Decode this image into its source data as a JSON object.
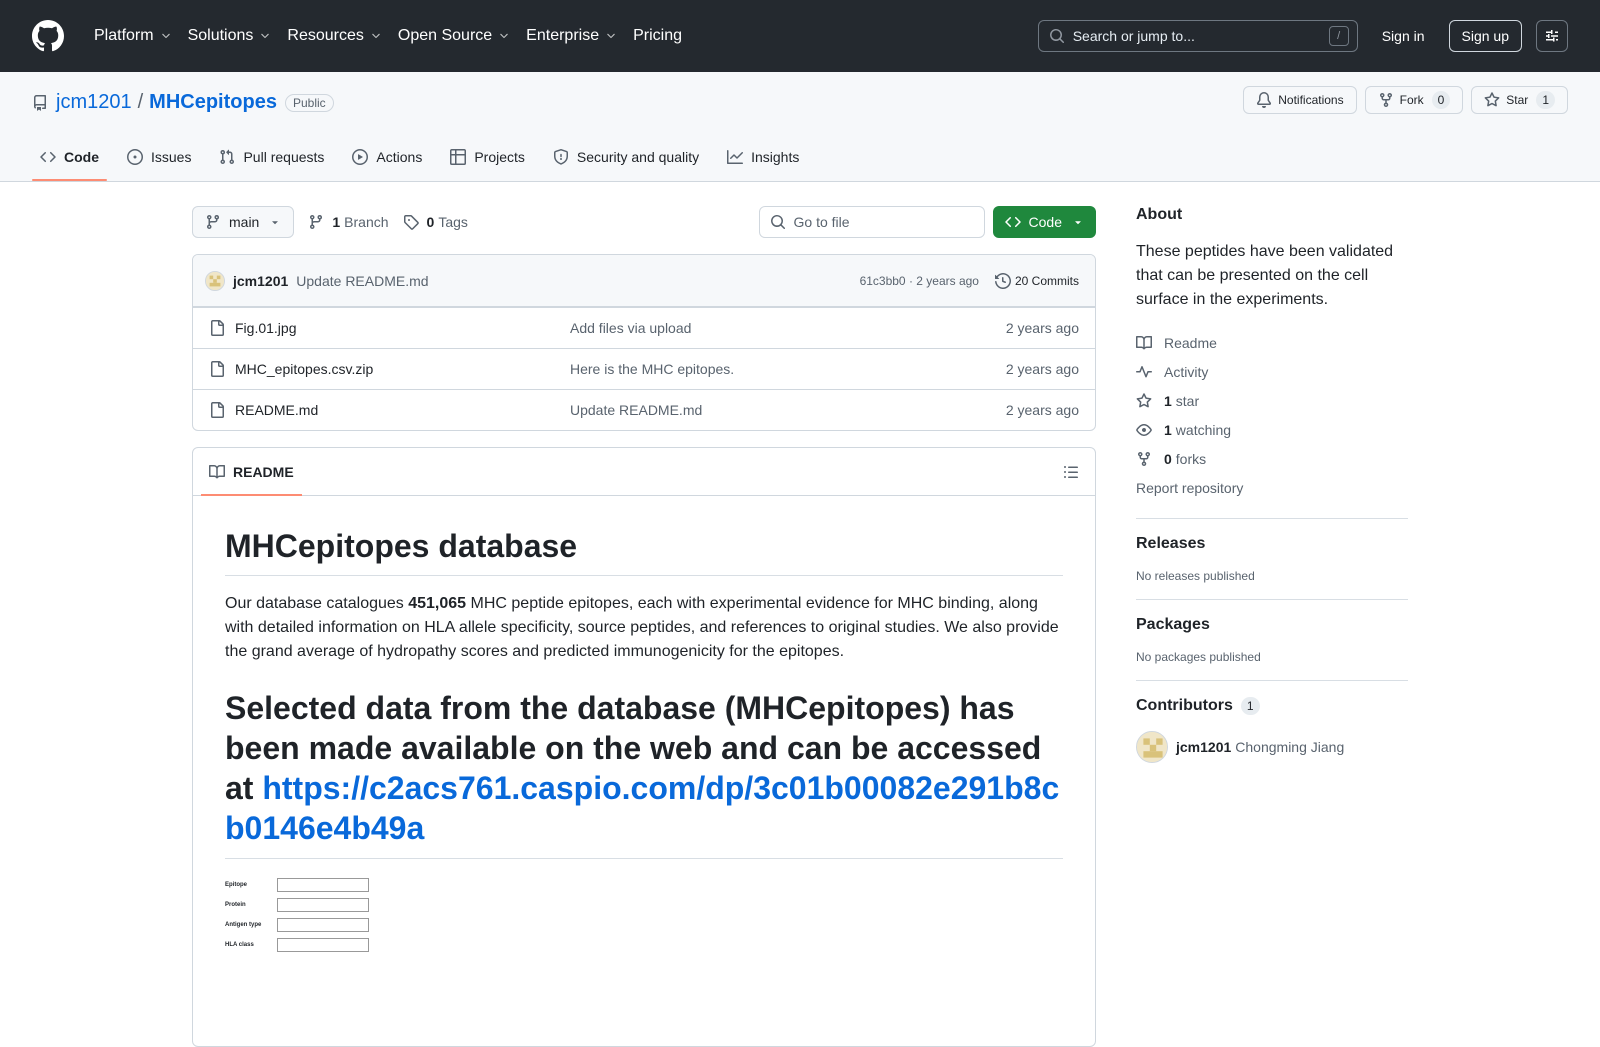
{
  "header": {
    "nav": [
      {
        "label": "Platform",
        "dropdown": true
      },
      {
        "label": "Solutions",
        "dropdown": true
      },
      {
        "label": "Resources",
        "dropdown": true
      },
      {
        "label": "Open Source",
        "dropdown": true
      },
      {
        "label": "Enterprise",
        "dropdown": true
      },
      {
        "label": "Pricing",
        "dropdown": false
      }
    ],
    "search_placeholder": "Search or jump to...",
    "search_kbd": "/",
    "sign_in": "Sign in",
    "sign_up": "Sign up"
  },
  "repo": {
    "owner": "jcm1201",
    "separator": "/",
    "name": "MHCepitopes",
    "visibility": "Public",
    "notifications_label": "Notifications",
    "fork_label": "Fork",
    "fork_count": "0",
    "star_label": "Star",
    "star_count": "1"
  },
  "tabs": [
    {
      "label": "Code",
      "icon": "code-icon",
      "active": true
    },
    {
      "label": "Issues",
      "icon": "issue-icon",
      "active": false
    },
    {
      "label": "Pull requests",
      "icon": "pull-request-icon",
      "active": false
    },
    {
      "label": "Actions",
      "icon": "play-icon",
      "active": false
    },
    {
      "label": "Projects",
      "icon": "table-icon",
      "active": false
    },
    {
      "label": "Security and quality",
      "icon": "shield-icon",
      "active": false
    },
    {
      "label": "Insights",
      "icon": "graph-icon",
      "active": false
    }
  ],
  "toolbar": {
    "branch": "main",
    "branch_count": "1",
    "branch_label": "Branch",
    "tag_count": "0",
    "tag_label": "Tags",
    "goto_placeholder": "Go to file",
    "code_label": "Code"
  },
  "commit": {
    "author": "jcm1201",
    "message": "Update README.md",
    "hash_age": "61c3bb0 · 2 years ago",
    "commits_label": "20 Commits"
  },
  "files": [
    {
      "name": "Fig.01.jpg",
      "message": "Add files via upload",
      "age": "2 years ago"
    },
    {
      "name": "MHC_epitopes.csv.zip",
      "message": "Here is the MHC epitopes.",
      "age": "2 years ago"
    },
    {
      "name": "README.md",
      "message": "Update README.md",
      "age": "2 years ago"
    }
  ],
  "readme": {
    "tab_label": "README",
    "title": "MHCepitopes database",
    "para_before": "Our database catalogues ",
    "para_bold": "451,065",
    "para_after": " MHC peptide epitopes, each with experimental evidence for MHC binding, along with detailed information on HLA allele specificity, source peptides, and references to original studies. We also provide the grand average of hydropathy scores and predicted immunogenicity for the epitopes.",
    "heading2_text": "Selected data from the database (MHCepitopes) has been made available on the web and can be accessed at ",
    "heading2_link": "https://c2acs761.caspio.com/dp/3c01b00082e291b8cb0146e4b49a",
    "figure_fields": [
      "Epitope",
      "Protein",
      "Antigen type",
      "HLA class"
    ]
  },
  "sidebar": {
    "about_title": "About",
    "description": "These peptides have been validated that can be presented on the cell surface in the experiments.",
    "readme": "Readme",
    "activity": "Activity",
    "stars_count": "1",
    "stars_label": "star",
    "watching_count": "1",
    "watching_label": "watching",
    "forks_count": "0",
    "forks_label": "forks",
    "report": "Report repository",
    "releases_title": "Releases",
    "releases_text": "No releases published",
    "packages_title": "Packages",
    "packages_text": "No packages published",
    "contributors_title": "Contributors",
    "contributors_count": "1",
    "contributor_login": "jcm1201",
    "contributor_name": "Chongming Jiang"
  },
  "colors": {
    "header_bg": "#24292f",
    "link": "#0969da",
    "code_button": "#1f883d",
    "active_tab_underline": "#fd8c73"
  }
}
